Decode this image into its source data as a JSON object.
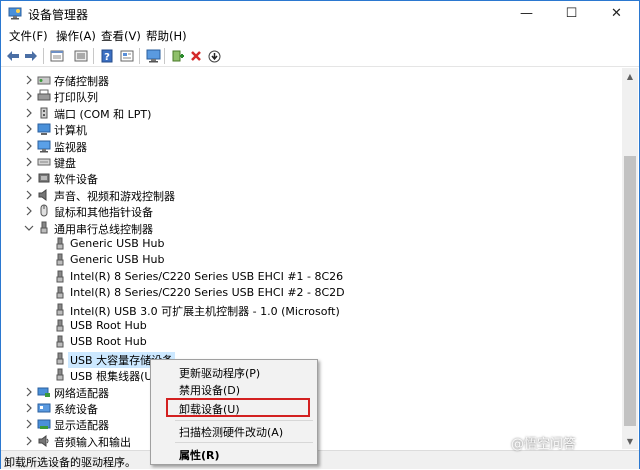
{
  "window": {
    "title": "设备管理器",
    "controls": {
      "minimize": "—",
      "maximize": "☐",
      "close": "✕"
    }
  },
  "menubar": {
    "items": [
      {
        "label": "文件(F)"
      },
      {
        "label": "操作(A)"
      },
      {
        "label": "查看(V)"
      },
      {
        "label": "帮助(H)"
      }
    ]
  },
  "toolbar": {
    "buttons": [
      "back-icon",
      "forward-icon",
      "properties-view-icon",
      "list-view-icon",
      "help-icon",
      "details-icon",
      "monitor-scan-icon",
      "add-driver-icon",
      "uninstall-x-icon",
      "download-icon"
    ]
  },
  "tree": {
    "rows": [
      {
        "label": "存储控制器",
        "icon": "storage-controller-icon",
        "expander": "collapsed",
        "level": 1
      },
      {
        "label": "打印队列",
        "icon": "print-queue-icon",
        "expander": "collapsed",
        "level": 1
      },
      {
        "label": "端口 (COM 和 LPT)",
        "icon": "port-icon",
        "expander": "collapsed",
        "level": 1
      },
      {
        "label": "计算机",
        "icon": "computer-icon",
        "expander": "collapsed",
        "level": 1
      },
      {
        "label": "监视器",
        "icon": "monitor-icon",
        "expander": "collapsed",
        "level": 1
      },
      {
        "label": "键盘",
        "icon": "keyboard-icon",
        "expander": "collapsed",
        "level": 1
      },
      {
        "label": "软件设备",
        "icon": "software-device-icon",
        "expander": "collapsed",
        "level": 1
      },
      {
        "label": "声音、视频和游戏控制器",
        "icon": "speaker-icon",
        "expander": "collapsed",
        "level": 1
      },
      {
        "label": "鼠标和其他指针设备",
        "icon": "mouse-icon",
        "expander": "collapsed",
        "level": 1
      },
      {
        "label": "通用串行总线控制器",
        "icon": "usb-icon",
        "expander": "expanded",
        "level": 1
      },
      {
        "label": "Generic USB Hub",
        "icon": "usb-icon",
        "expander": "none",
        "level": 2
      },
      {
        "label": "Generic USB Hub",
        "icon": "usb-icon",
        "expander": "none",
        "level": 2
      },
      {
        "label": "Intel(R) 8 Series/C220 Series USB EHCI #1 - 8C26",
        "icon": "usb-icon",
        "expander": "none",
        "level": 2
      },
      {
        "label": "Intel(R) 8 Series/C220 Series USB EHCI #2 - 8C2D",
        "icon": "usb-icon",
        "expander": "none",
        "level": 2
      },
      {
        "label": "Intel(R) USB 3.0 可扩展主机控制器 - 1.0 (Microsoft)",
        "icon": "usb-icon",
        "expander": "none",
        "level": 2
      },
      {
        "label": "USB Root Hub",
        "icon": "usb-icon",
        "expander": "none",
        "level": 2
      },
      {
        "label": "USB Root Hub",
        "icon": "usb-icon",
        "expander": "none",
        "level": 2
      },
      {
        "label": "USB 大容量存储设备",
        "icon": "usb-icon",
        "expander": "none",
        "level": 2,
        "selected": true
      },
      {
        "label": "USB 根集线器(USB",
        "icon": "usb-icon",
        "expander": "none",
        "level": 2
      },
      {
        "label": "网络适配器",
        "icon": "network-adapter-icon",
        "expander": "collapsed",
        "level": 1
      },
      {
        "label": "系统设备",
        "icon": "system-device-icon",
        "expander": "collapsed",
        "level": 1
      },
      {
        "label": "显示适配器",
        "icon": "display-adapter-icon",
        "expander": "collapsed",
        "level": 1
      },
      {
        "label": "音频输入和输出",
        "icon": "audio-io-icon",
        "expander": "collapsed",
        "level": 1
      }
    ]
  },
  "context_menu": {
    "items": [
      {
        "label": "更新驱动程序(P)",
        "bold": false
      },
      {
        "label": "禁用设备(D)",
        "bold": false
      },
      {
        "label": "卸载设备(U)",
        "bold": false,
        "highlighted": true
      },
      {
        "separator": true
      },
      {
        "label": "扫描检测硬件改动(A)",
        "bold": false
      },
      {
        "separator": true
      },
      {
        "label": "属性(R)",
        "bold": true
      }
    ]
  },
  "statusbar": {
    "text": "卸载所选设备的驱动程序。"
  },
  "watermark": {
    "text": "@悟空问答"
  },
  "colors": {
    "selection": "#cce8ff",
    "highlight_box": "#d32020",
    "window_border": "#2b78d0"
  }
}
